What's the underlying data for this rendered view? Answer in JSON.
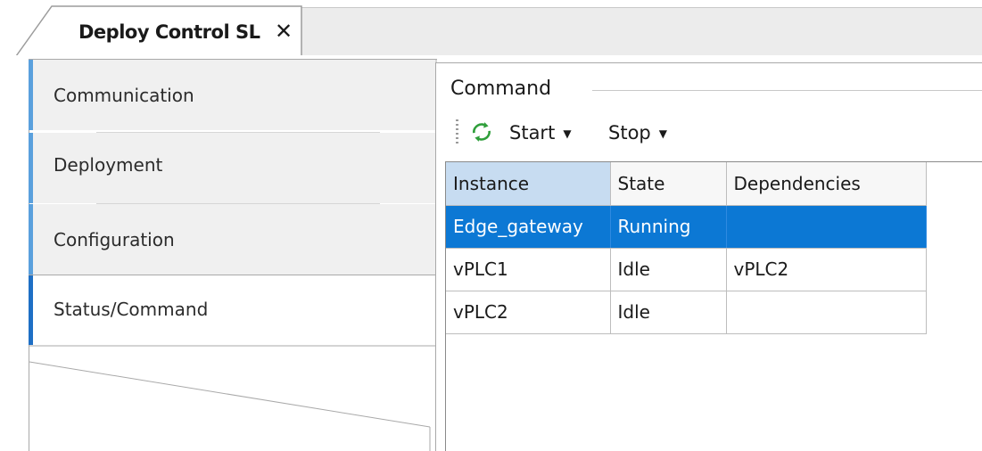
{
  "document_tab": {
    "title": "Deploy Control SL",
    "close_glyph": "✕"
  },
  "nav": {
    "items": [
      {
        "label": "Communication",
        "active": false
      },
      {
        "label": "Deployment",
        "active": false
      },
      {
        "label": "Configuration",
        "active": false
      },
      {
        "label": "Status/Command",
        "active": true
      }
    ]
  },
  "command": {
    "title": "Command",
    "toolbar": {
      "refresh_icon": "refresh-arrows-icon",
      "start_label": "Start",
      "stop_label": "Stop",
      "caret_glyph": "▼"
    }
  },
  "table": {
    "columns": [
      "Instance",
      "State",
      "Dependencies"
    ],
    "rows": [
      {
        "instance": "Edge_gateway",
        "state": "Running",
        "dependencies": "",
        "selected": true
      },
      {
        "instance": "vPLC1",
        "state": "Idle",
        "dependencies": "vPLC2",
        "selected": false
      },
      {
        "instance": "vPLC2",
        "state": "Idle",
        "dependencies": "",
        "selected": false
      }
    ]
  },
  "colors": {
    "accent": "#1e6fc5",
    "selection": "#0c78d4",
    "header_sorted": "#c7dcf1",
    "icon_green": "#2e9e3a"
  }
}
